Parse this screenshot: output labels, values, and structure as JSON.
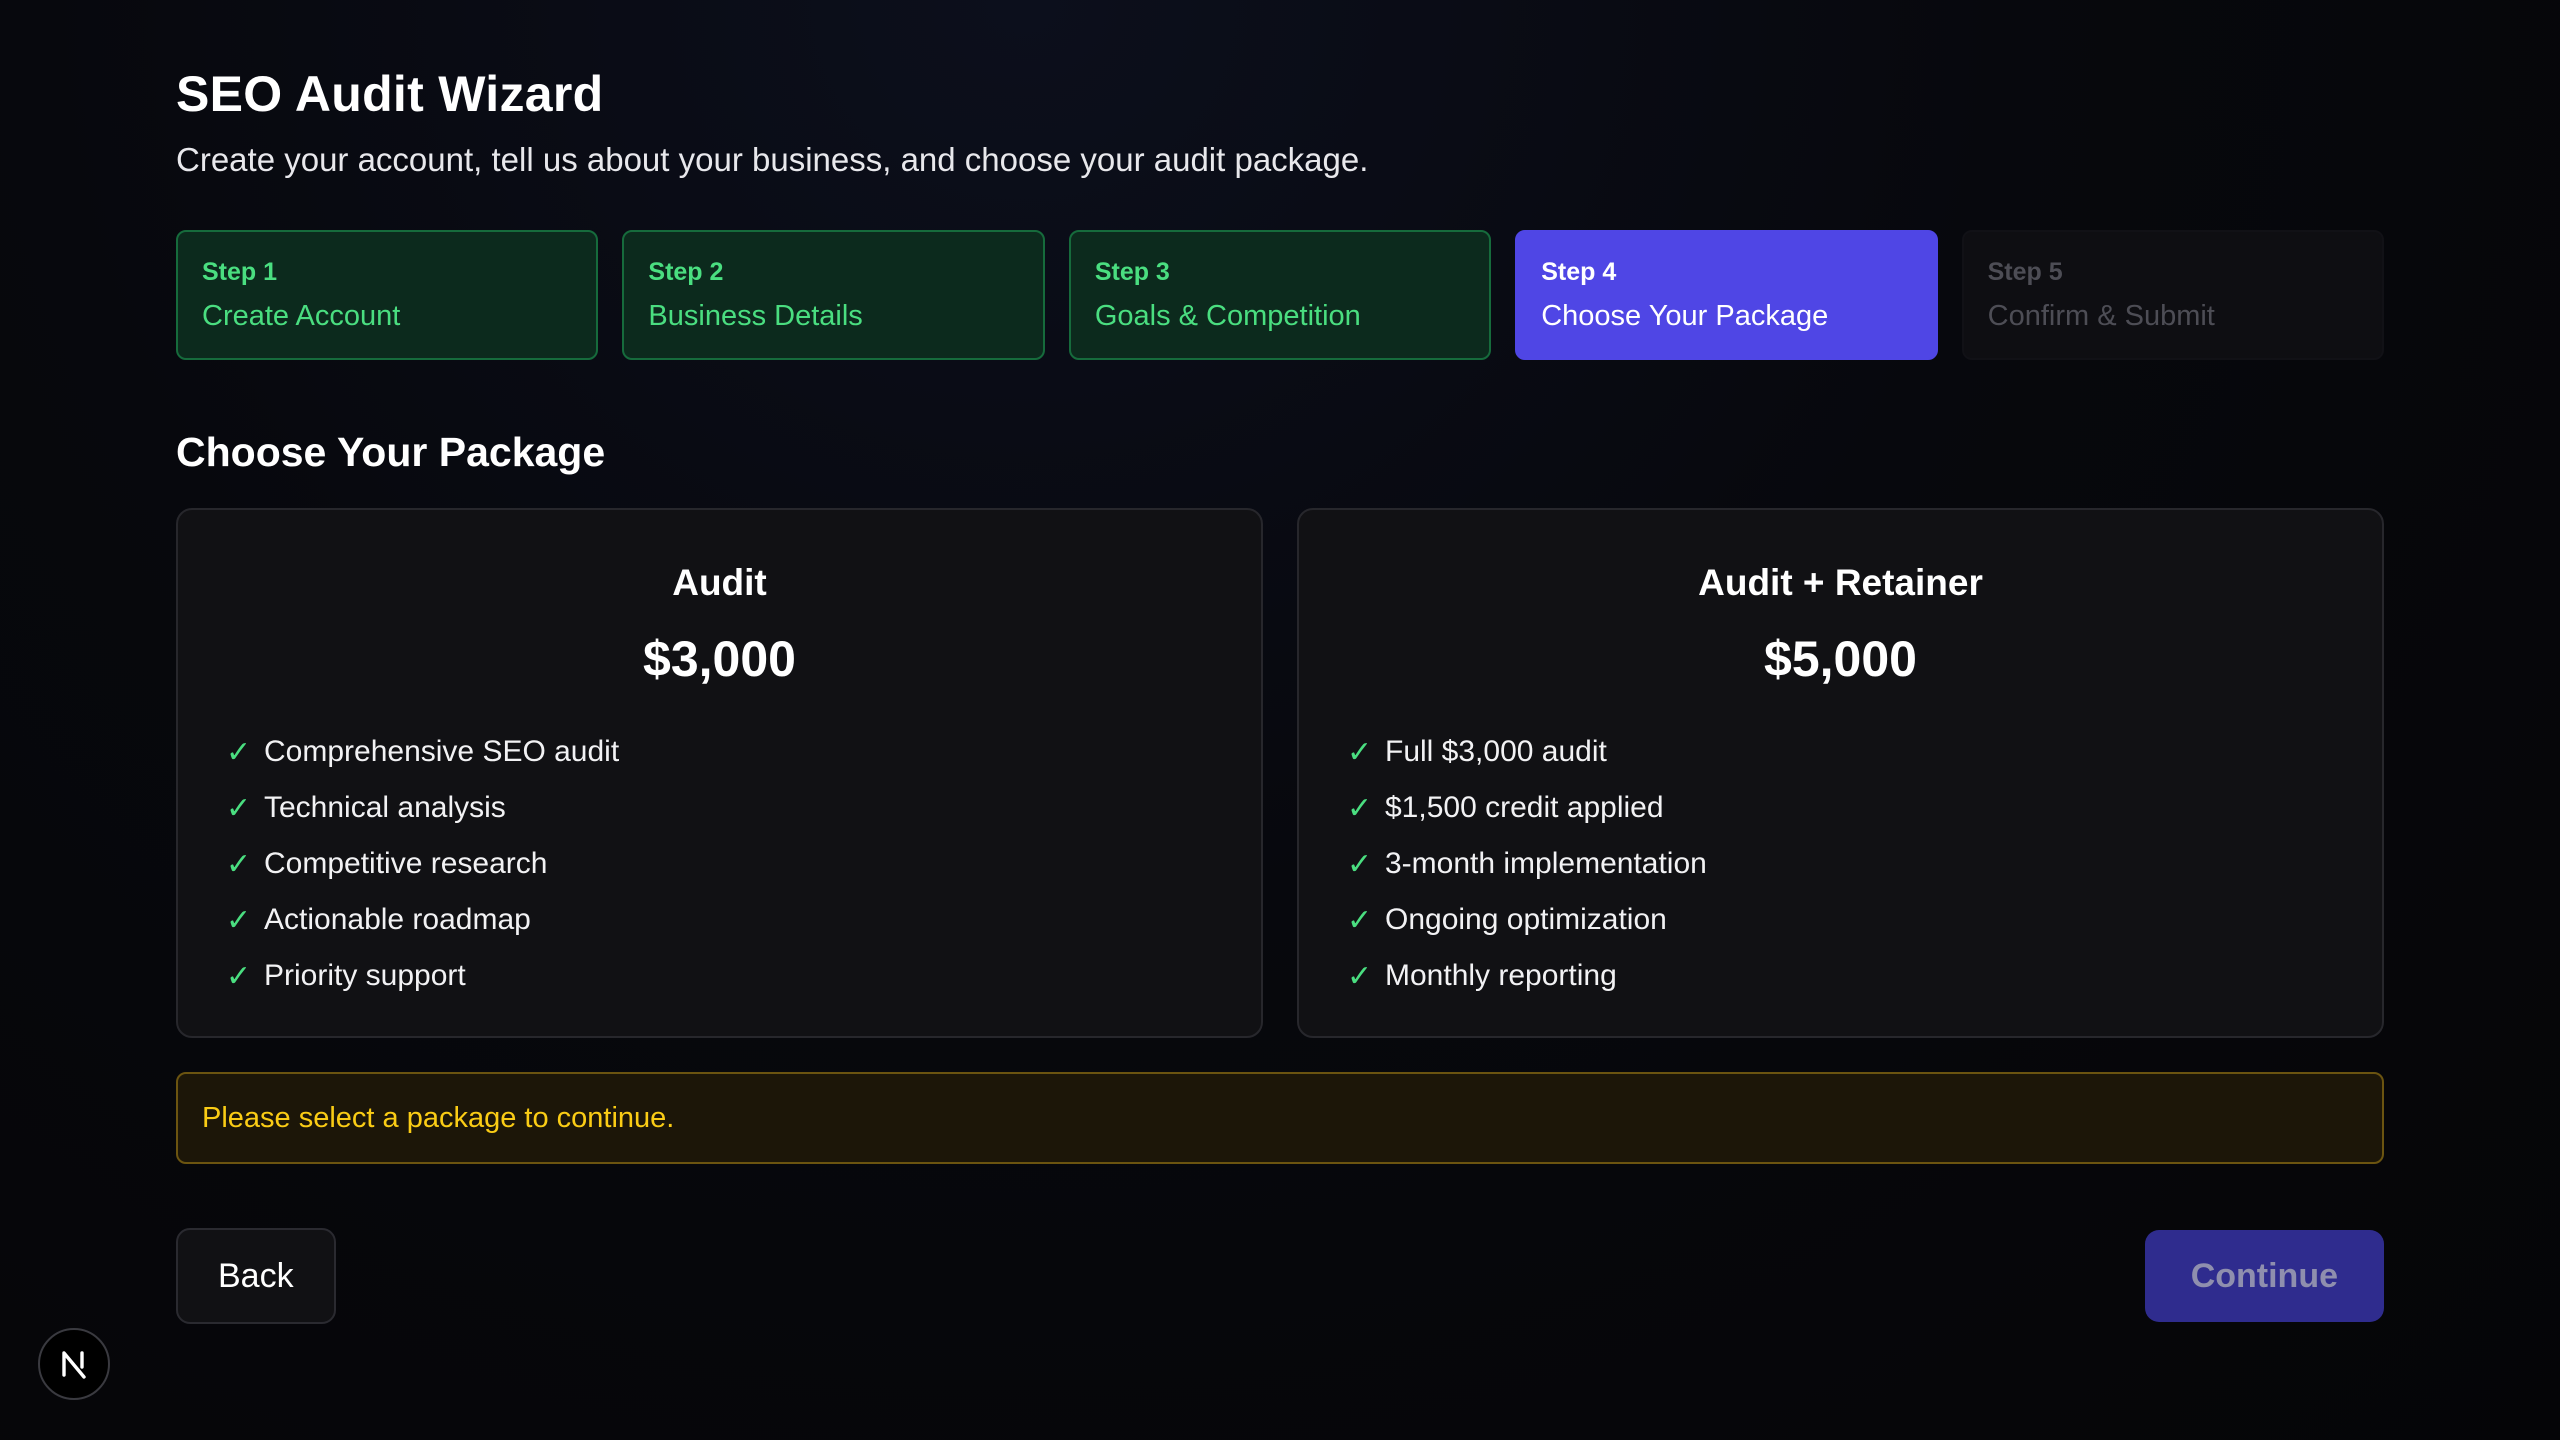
{
  "header": {
    "title": "SEO Audit Wizard",
    "subtitle": "Create your account, tell us about your business, and choose your audit package."
  },
  "steps": [
    {
      "number": "Step 1",
      "label": "Create Account",
      "status": "complete"
    },
    {
      "number": "Step 2",
      "label": "Business Details",
      "status": "complete"
    },
    {
      "number": "Step 3",
      "label": "Goals & Competition",
      "status": "complete"
    },
    {
      "number": "Step 4",
      "label": "Choose Your Package",
      "status": "current"
    },
    {
      "number": "Step 5",
      "label": "Confirm & Submit",
      "status": "upcoming"
    }
  ],
  "section": {
    "title": "Choose Your Package"
  },
  "packages": [
    {
      "name": "Audit",
      "price": "$3,000",
      "features": [
        "Comprehensive SEO audit",
        "Technical analysis",
        "Competitive research",
        "Actionable roadmap",
        "Priority support"
      ]
    },
    {
      "name": "Audit + Retainer",
      "price": "$5,000",
      "features": [
        "Full $3,000 audit",
        "$1,500 credit applied",
        "3-month implementation",
        "Ongoing optimization",
        "Monthly reporting"
      ]
    }
  ],
  "alert": {
    "message": "Please select a package to continue."
  },
  "actions": {
    "back_label": "Back",
    "continue_label": "Continue"
  },
  "icons": {
    "check": "check-icon",
    "badge": "nextjs-logo-icon"
  },
  "colors": {
    "accent": "#4f46e5",
    "success": "#4ade80",
    "warning": "#facc15",
    "background": "#050508"
  }
}
